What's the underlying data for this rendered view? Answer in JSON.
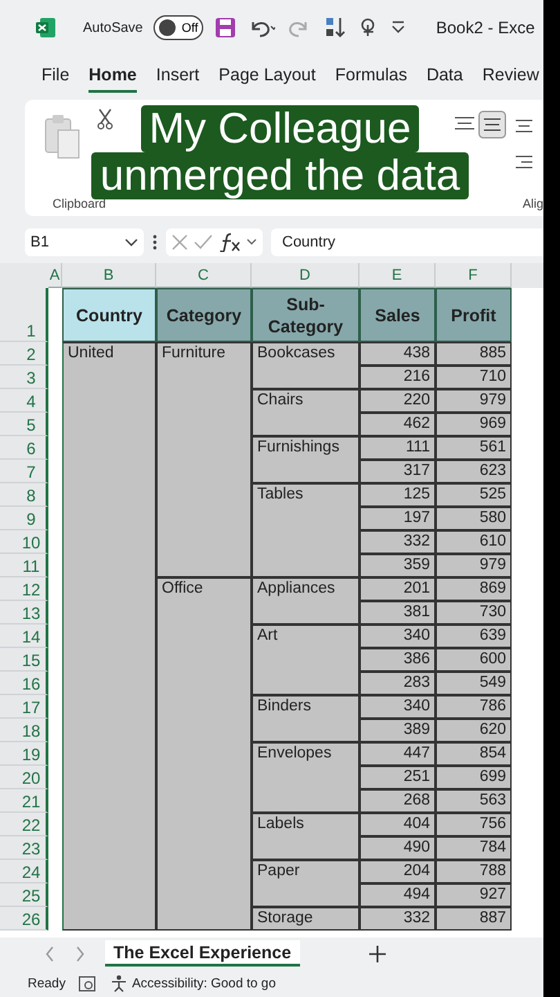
{
  "title_bar": {
    "autosave_label": "AutoSave",
    "autosave": {
      "on": false,
      "label": "Off"
    },
    "title": "Book2  -  Exce"
  },
  "menu_tabs": [
    {
      "label": "File",
      "selected": false
    },
    {
      "label": "Home",
      "selected": true
    },
    {
      "label": "Insert",
      "selected": false
    },
    {
      "label": "Page Layout",
      "selected": false
    },
    {
      "label": "Formulas",
      "selected": false
    },
    {
      "label": "Data",
      "selected": false
    },
    {
      "label": "Review",
      "selected": false
    }
  ],
  "ribbon": {
    "group_labels": [
      "Clipboard",
      "Alig"
    ]
  },
  "caption": [
    "My Colleague",
    "unmerged the data"
  ],
  "formula_bar": {
    "name_box": "B1",
    "value": "Country"
  },
  "columns": [
    {
      "label": "A"
    },
    {
      "label": "B"
    },
    {
      "label": "C"
    },
    {
      "label": "D"
    },
    {
      "label": "E"
    },
    {
      "label": "F"
    }
  ],
  "header_row": {
    "row_number": "1",
    "cells": [
      {
        "text": "Country",
        "selected": true
      },
      {
        "text": "Category",
        "selected": false
      },
      {
        "text": "Sub-Category",
        "selected": false
      },
      {
        "text": "Sales",
        "selected": false
      },
      {
        "text": "Profit",
        "selected": false
      }
    ]
  },
  "country": "United",
  "categories": [
    {
      "name": "Furniture",
      "subcategories": [
        {
          "name": "Bookcases",
          "rows": [
            [
              "438",
              "885"
            ],
            [
              "216",
              "710"
            ]
          ]
        },
        {
          "name": "Chairs",
          "rows": [
            [
              "220",
              "979"
            ],
            [
              "462",
              "969"
            ]
          ]
        },
        {
          "name": "Furnishings",
          "rows": [
            [
              "111",
              "561"
            ],
            [
              "317",
              "623"
            ]
          ]
        },
        {
          "name": "Tables",
          "rows": [
            [
              "125",
              "525"
            ],
            [
              "197",
              "580"
            ],
            [
              "332",
              "610"
            ],
            [
              "359",
              "979"
            ]
          ]
        }
      ]
    },
    {
      "name": "Office",
      "subcategories": [
        {
          "name": "Appliances",
          "rows": [
            [
              "201",
              "869"
            ],
            [
              "381",
              "730"
            ]
          ]
        },
        {
          "name": "Art",
          "rows": [
            [
              "340",
              "639"
            ],
            [
              "386",
              "600"
            ],
            [
              "283",
              "549"
            ]
          ]
        },
        {
          "name": "Binders",
          "rows": [
            [
              "340",
              "786"
            ],
            [
              "389",
              "620"
            ]
          ]
        },
        {
          "name": "Envelopes",
          "rows": [
            [
              "447",
              "854"
            ],
            [
              "251",
              "699"
            ],
            [
              "268",
              "563"
            ]
          ]
        },
        {
          "name": "Labels",
          "rows": [
            [
              "404",
              "756"
            ],
            [
              "490",
              "784"
            ]
          ]
        },
        {
          "name": "Paper",
          "rows": [
            [
              "204",
              "788"
            ],
            [
              "494",
              "927"
            ]
          ]
        },
        {
          "name": "Storage",
          "rows": [
            [
              "332",
              "887"
            ]
          ]
        }
      ]
    }
  ],
  "row_numbers": [
    "2",
    "3",
    "4",
    "5",
    "6",
    "7",
    "8",
    "9",
    "10",
    "11",
    "12",
    "13",
    "14",
    "15",
    "16",
    "17",
    "18",
    "19",
    "20",
    "21",
    "22",
    "23",
    "24",
    "25",
    "26"
  ],
  "sheet_tabs": [
    {
      "label": "The Excel Experience",
      "selected": true
    }
  ],
  "status_bar": {
    "ready": "Ready",
    "accessibility": "Accessibility: Good to go"
  }
}
